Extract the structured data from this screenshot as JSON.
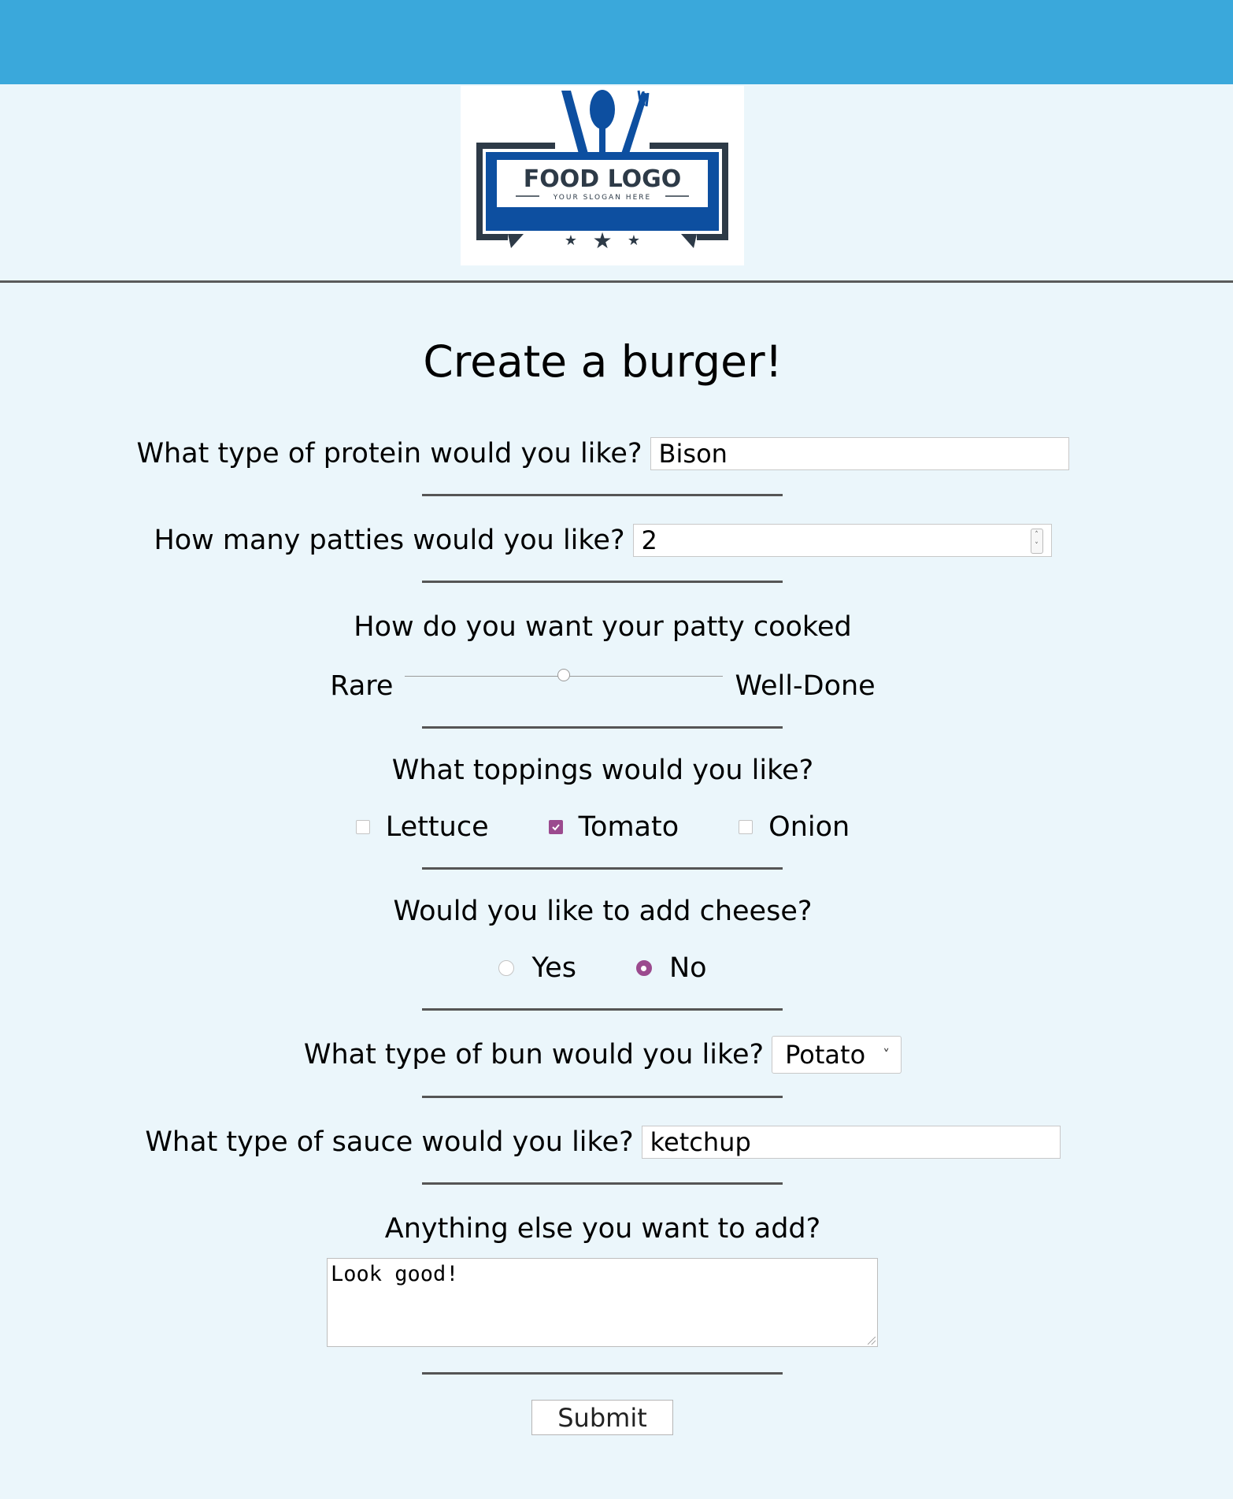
{
  "logo": {
    "name": "FOOD LOGO",
    "slogan": "YOUR SLOGAN HERE",
    "colors": {
      "blue": "#0d4fa0",
      "dark": "#2d3a47"
    }
  },
  "page": {
    "title": "Create a burger!"
  },
  "form": {
    "protein": {
      "label": "What type of protein would you like?",
      "value": "Bison"
    },
    "patties": {
      "label": "How many patties would you like?",
      "value": "2"
    },
    "cook": {
      "label": "How do you want your patty cooked",
      "min_label": "Rare",
      "max_label": "Well-Done",
      "level": 0.5
    },
    "toppings": {
      "label": "What toppings would you like?",
      "options": [
        {
          "label": "Lettuce",
          "checked": false
        },
        {
          "label": "Tomato",
          "checked": true
        },
        {
          "label": "Onion",
          "checked": false
        }
      ]
    },
    "cheese": {
      "label": "Would you like to add cheese?",
      "options": [
        {
          "label": "Yes",
          "checked": false
        },
        {
          "label": "No",
          "checked": true
        }
      ]
    },
    "bun": {
      "label": "What type of bun would you like?",
      "value": "Potato"
    },
    "sauce": {
      "label": "What type of sauce would you like?",
      "value": "ketchup"
    },
    "notes": {
      "label": "Anything else you want to add?",
      "value": "Look good!"
    },
    "submit_label": "Submit"
  },
  "colors": {
    "header": "#3aa8db",
    "background": "#ebf6fb",
    "accent": "#9b4a8e"
  }
}
